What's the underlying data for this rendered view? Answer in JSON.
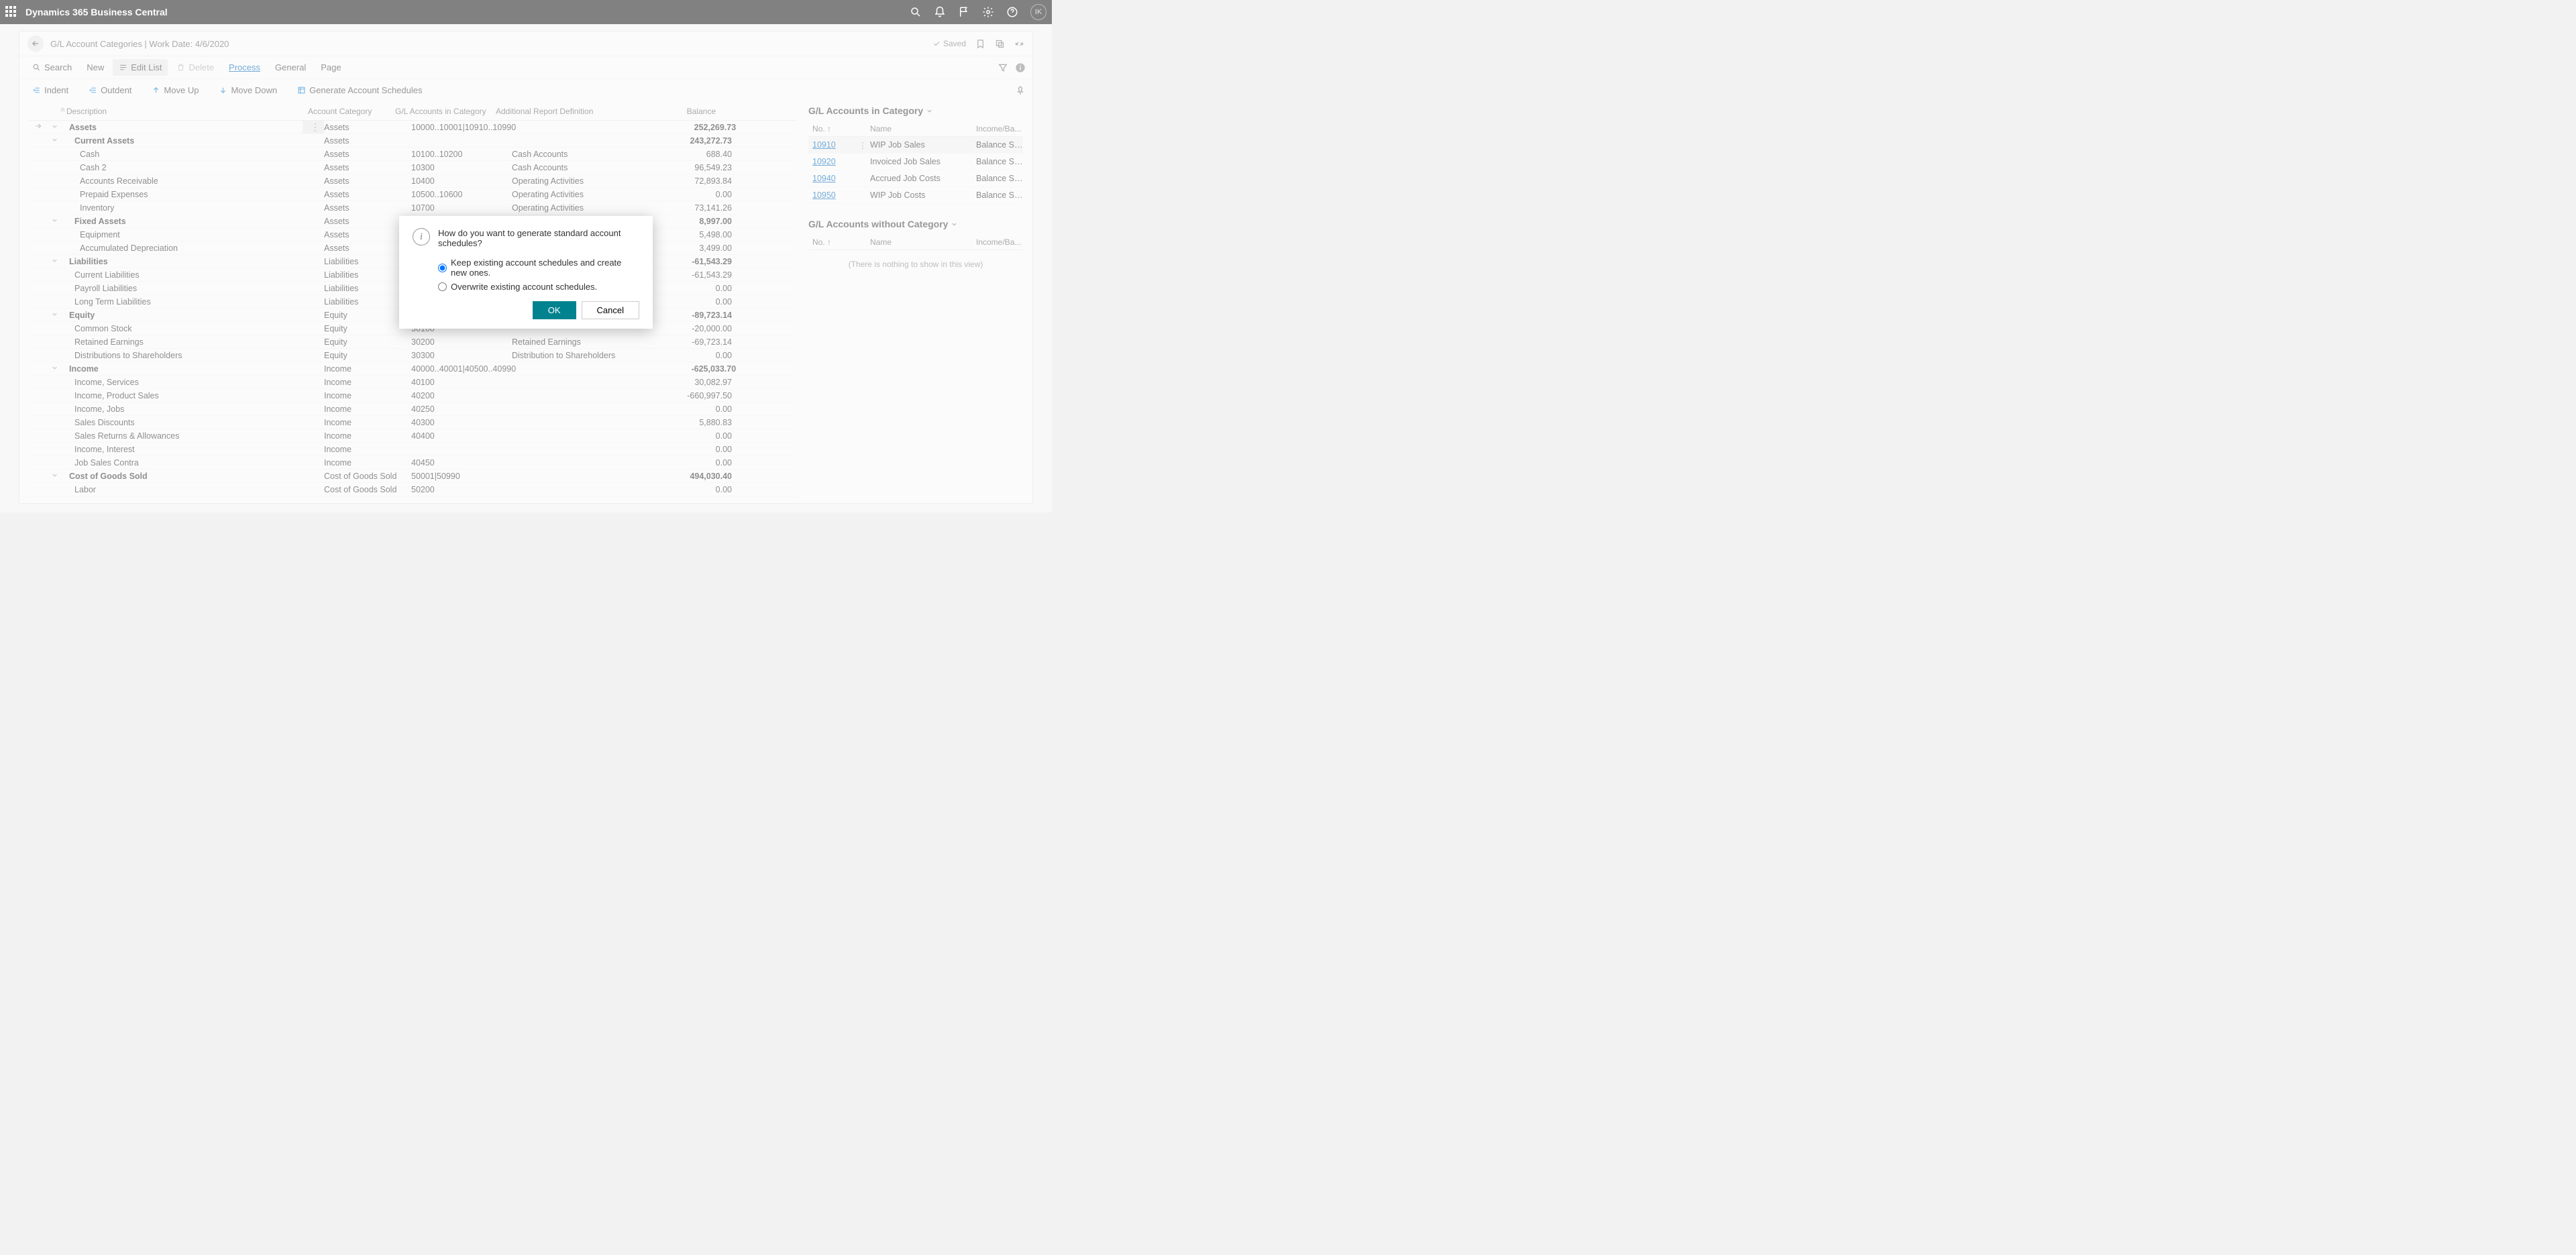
{
  "app_title": "Dynamics 365 Business Central",
  "avatar_initials": "IK",
  "breadcrumb": "G/L Account Categories | Work Date: 4/6/2020",
  "saved_label": "Saved",
  "toolbar": {
    "search": "Search",
    "new": "New",
    "edit_list": "Edit List",
    "delete": "Delete",
    "process": "Process",
    "general": "General",
    "page": "Page"
  },
  "subtoolbar": {
    "indent": "Indent",
    "outdent": "Outdent",
    "move_up": "Move Up",
    "move_down": "Move Down",
    "generate": "Generate Account Schedules"
  },
  "columns": {
    "description": "Description",
    "account_category": "Account Category",
    "gl_in_category": "G/L Accounts in Category",
    "additional_report": "Additional Report Definition",
    "balance": "Balance"
  },
  "rows": [
    {
      "indent": 0,
      "bold": true,
      "chev": true,
      "sel": true,
      "desc": "Assets",
      "cat": "Assets",
      "gla": "10000..10001|10910..10990",
      "ard": "",
      "bal": "252,269.73"
    },
    {
      "indent": 1,
      "bold": true,
      "chev": true,
      "desc": "Current Assets",
      "cat": "Assets",
      "gla": "",
      "ard": "",
      "bal": "243,272.73"
    },
    {
      "indent": 2,
      "desc": "Cash",
      "cat": "Assets",
      "gla": "10100..10200",
      "ard": "Cash Accounts",
      "bal": "688.40"
    },
    {
      "indent": 2,
      "desc": "Cash 2",
      "cat": "Assets",
      "gla": "10300",
      "ard": "Cash Accounts",
      "bal": "96,549.23"
    },
    {
      "indent": 2,
      "desc": "Accounts Receivable",
      "cat": "Assets",
      "gla": "10400",
      "ard": "Operating Activities",
      "bal": "72,893.84"
    },
    {
      "indent": 2,
      "desc": "Prepaid Expenses",
      "cat": "Assets",
      "gla": "10500..10600",
      "ard": "Operating Activities",
      "bal": "0.00"
    },
    {
      "indent": 2,
      "desc": "Inventory",
      "cat": "Assets",
      "gla": "10700",
      "ard": "Operating Activities",
      "bal": "73,141.26"
    },
    {
      "indent": 1,
      "bold": true,
      "chev": true,
      "desc": "Fixed Assets",
      "cat": "Assets",
      "gla": "",
      "ard": "",
      "bal": "8,997.00"
    },
    {
      "indent": 2,
      "desc": "Equipment",
      "cat": "Assets",
      "gla": "",
      "ard": "",
      "bal": "5,498.00"
    },
    {
      "indent": 2,
      "desc": "Accumulated Depreciation",
      "cat": "Assets",
      "gla": "",
      "ard": "",
      "bal": "3,499.00"
    },
    {
      "indent": 0,
      "bold": true,
      "chev": true,
      "desc": "Liabilities",
      "cat": "Liabilities",
      "gla": "",
      "ard": "",
      "bal": "-61,543.29"
    },
    {
      "indent": 1,
      "desc": "Current Liabilities",
      "cat": "Liabilities",
      "gla": "",
      "ard": "",
      "bal": "-61,543.29"
    },
    {
      "indent": 1,
      "desc": "Payroll Liabilities",
      "cat": "Liabilities",
      "gla": "",
      "ard": "",
      "bal": "0.00"
    },
    {
      "indent": 1,
      "desc": "Long Term Liabilities",
      "cat": "Liabilities",
      "gla": "",
      "ard": "",
      "bal": "0.00"
    },
    {
      "indent": 0,
      "bold": true,
      "chev": true,
      "desc": "Equity",
      "cat": "Equity",
      "gla": "",
      "ard": "",
      "bal": "-89,723.14"
    },
    {
      "indent": 1,
      "desc": "Common Stock",
      "cat": "Equity",
      "gla": "30100",
      "ard": "",
      "bal": "-20,000.00"
    },
    {
      "indent": 1,
      "desc": "Retained Earnings",
      "cat": "Equity",
      "gla": "30200",
      "ard": "Retained Earnings",
      "bal": "-69,723.14"
    },
    {
      "indent": 1,
      "desc": "Distributions to Shareholders",
      "cat": "Equity",
      "gla": "30300",
      "ard": "Distribution to Shareholders",
      "bal": "0.00"
    },
    {
      "indent": 0,
      "bold": true,
      "chev": true,
      "desc": "Income",
      "cat": "Income",
      "gla": "40000..40001|40500..40990",
      "ard": "",
      "bal": "-625,033.70"
    },
    {
      "indent": 1,
      "desc": "Income, Services",
      "cat": "Income",
      "gla": "40100",
      "ard": "",
      "bal": "30,082.97"
    },
    {
      "indent": 1,
      "desc": "Income, Product Sales",
      "cat": "Income",
      "gla": "40200",
      "ard": "",
      "bal": "-660,997.50"
    },
    {
      "indent": 1,
      "desc": "Income, Jobs",
      "cat": "Income",
      "gla": "40250",
      "ard": "",
      "bal": "0.00"
    },
    {
      "indent": 1,
      "desc": "Sales Discounts",
      "cat": "Income",
      "gla": "40300",
      "ard": "",
      "bal": "5,880.83"
    },
    {
      "indent": 1,
      "desc": "Sales Returns & Allowances",
      "cat": "Income",
      "gla": "40400",
      "ard": "",
      "bal": "0.00"
    },
    {
      "indent": 1,
      "desc": "Income, Interest",
      "cat": "Income",
      "gla": "",
      "ard": "",
      "bal": "0.00"
    },
    {
      "indent": 1,
      "desc": "Job Sales Contra",
      "cat": "Income",
      "gla": "40450",
      "ard": "",
      "bal": "0.00"
    },
    {
      "indent": 0,
      "bold": true,
      "chev": true,
      "desc": "Cost of Goods Sold",
      "cat": "Cost of Goods Sold",
      "gla": "50001|50990",
      "ard": "",
      "bal": "494,030.40"
    },
    {
      "indent": 1,
      "desc": "Labor",
      "cat": "Cost of Goods Sold",
      "gla": "50200",
      "ard": "",
      "bal": "0.00"
    }
  ],
  "side": {
    "in_title": "G/L Accounts in Category",
    "without_title": "G/L Accounts without Category",
    "col_no": "No. ↑",
    "col_name": "Name",
    "col_ib": "Income/Ba...",
    "in_rows": [
      {
        "no": "10910",
        "name": "WIP Job Sales",
        "ib": "Balance Sh...",
        "sel": true
      },
      {
        "no": "10920",
        "name": "Invoiced Job Sales",
        "ib": "Balance Sh..."
      },
      {
        "no": "10940",
        "name": "Accrued Job Costs",
        "ib": "Balance Sh..."
      },
      {
        "no": "10950",
        "name": "WIP Job Costs",
        "ib": "Balance Sh..."
      }
    ],
    "empty_msg": "(There is nothing to show in this view)"
  },
  "dialog": {
    "message": "How do you want to generate standard account schedules?",
    "opt_keep": "Keep existing account schedules and create new ones.",
    "opt_overwrite": "Overwrite existing account schedules.",
    "ok": "OK",
    "cancel": "Cancel"
  }
}
